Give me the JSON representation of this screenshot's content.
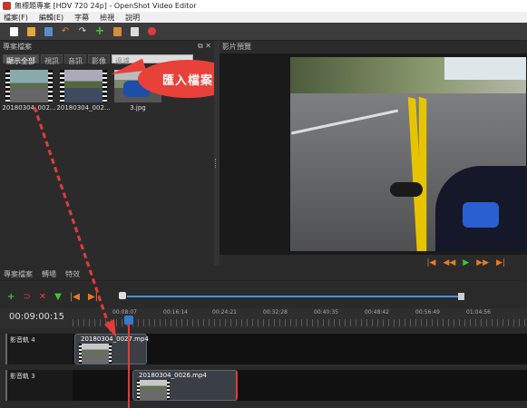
{
  "window": {
    "title": "無標題專案 [HDV 720 24p] - OpenShot Video Editor"
  },
  "menu": [
    "檔案(F)",
    "編輯(E)",
    "字幕",
    "檢視",
    "說明"
  ],
  "toolbar": {
    "icons": [
      "new-project-icon",
      "open-project-icon",
      "save-project-icon",
      "undo-icon",
      "redo-icon",
      "import-files-icon",
      "profile-icon",
      "fullscreen-icon",
      "export-video-icon"
    ]
  },
  "project_files": {
    "title": "專案檔案",
    "tabs": [
      "顯示全部",
      "視訊",
      "音訊",
      "影像"
    ],
    "filter_placeholder": "過濾",
    "files": [
      {
        "name": "20180304_002...",
        "type": "video"
      },
      {
        "name": "20180304_002...",
        "type": "video"
      },
      {
        "name": "3.jpg",
        "type": "image"
      }
    ]
  },
  "callout": {
    "text": "匯入檔案"
  },
  "preview": {
    "title": "影片預覽"
  },
  "bottom_tabs": [
    "專案檔案",
    "轉場",
    "特效"
  ],
  "timeline": {
    "current_time": "00:09:00:15",
    "ruler_labels": [
      "00:08:07",
      "00:16:14",
      "00:24:21",
      "00:32:28",
      "00:40:35",
      "00:48:42",
      "00:56:49",
      "01:04:56"
    ],
    "tracks": [
      {
        "label": "影音軌 4",
        "clip": "20180304_0027.mp4"
      },
      {
        "label": "影音軌 3",
        "clip": "20180304_0026.mp4"
      }
    ]
  },
  "colors": {
    "accent_orange": "#e97a22",
    "play_green": "#3fc23f",
    "callout_red": "#e8413a",
    "playhead_blue": "#2d7fd6"
  }
}
